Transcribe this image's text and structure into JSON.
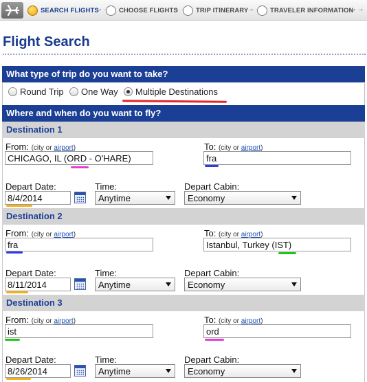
{
  "progress_steps": [
    {
      "label": "SEARCH FLIGHTS",
      "active": true
    },
    {
      "label": "CHOOSE FLIGHTS",
      "active": false
    },
    {
      "label": "TRIP ITINERARY",
      "active": false
    },
    {
      "label": "TRAVELER INFORMATION",
      "active": false
    }
  ],
  "step_arrow": "→ →",
  "page_title": "Flight Search",
  "trip_type": {
    "heading": "What type of trip do you want to take?",
    "options": [
      "Round Trip",
      "One Way",
      "Multiple Destinations"
    ],
    "selected": "Multiple Destinations"
  },
  "where_when_heading": "Where and when do you want to fly?",
  "labels": {
    "from": "From:",
    "to": "To:",
    "city_or": "(city or ",
    "airport": "airport",
    "close_paren": ")",
    "depart_date": "Depart Date:",
    "time": "Time:",
    "depart_cabin": "Depart Cabin:"
  },
  "destinations": [
    {
      "heading": "Destination 1",
      "from": "CHICAGO, IL (ORD - O'HARE)",
      "to": "fra",
      "depart_date": "8/4/2014",
      "time": "Anytime",
      "cabin": "Economy"
    },
    {
      "heading": "Destination 2",
      "from": "fra",
      "to": "Istanbul, Turkey (IST)",
      "depart_date": "8/11/2014",
      "time": "Anytime",
      "cabin": "Economy"
    },
    {
      "heading": "Destination 3",
      "from": "ist",
      "to": "ord",
      "depart_date": "8/26/2014",
      "time": "Anytime",
      "cabin": "Economy"
    }
  ],
  "highlight_colors": {
    "red": "#e3262b",
    "magenta": "#e040d0",
    "blue": "#2a3fe0",
    "green": "#24c21e",
    "orange": "#f5b21a"
  },
  "theme": {
    "bar": "#1c3f96",
    "title": "#1a3a8f",
    "dest_head_bg": "#d3d3d3"
  }
}
